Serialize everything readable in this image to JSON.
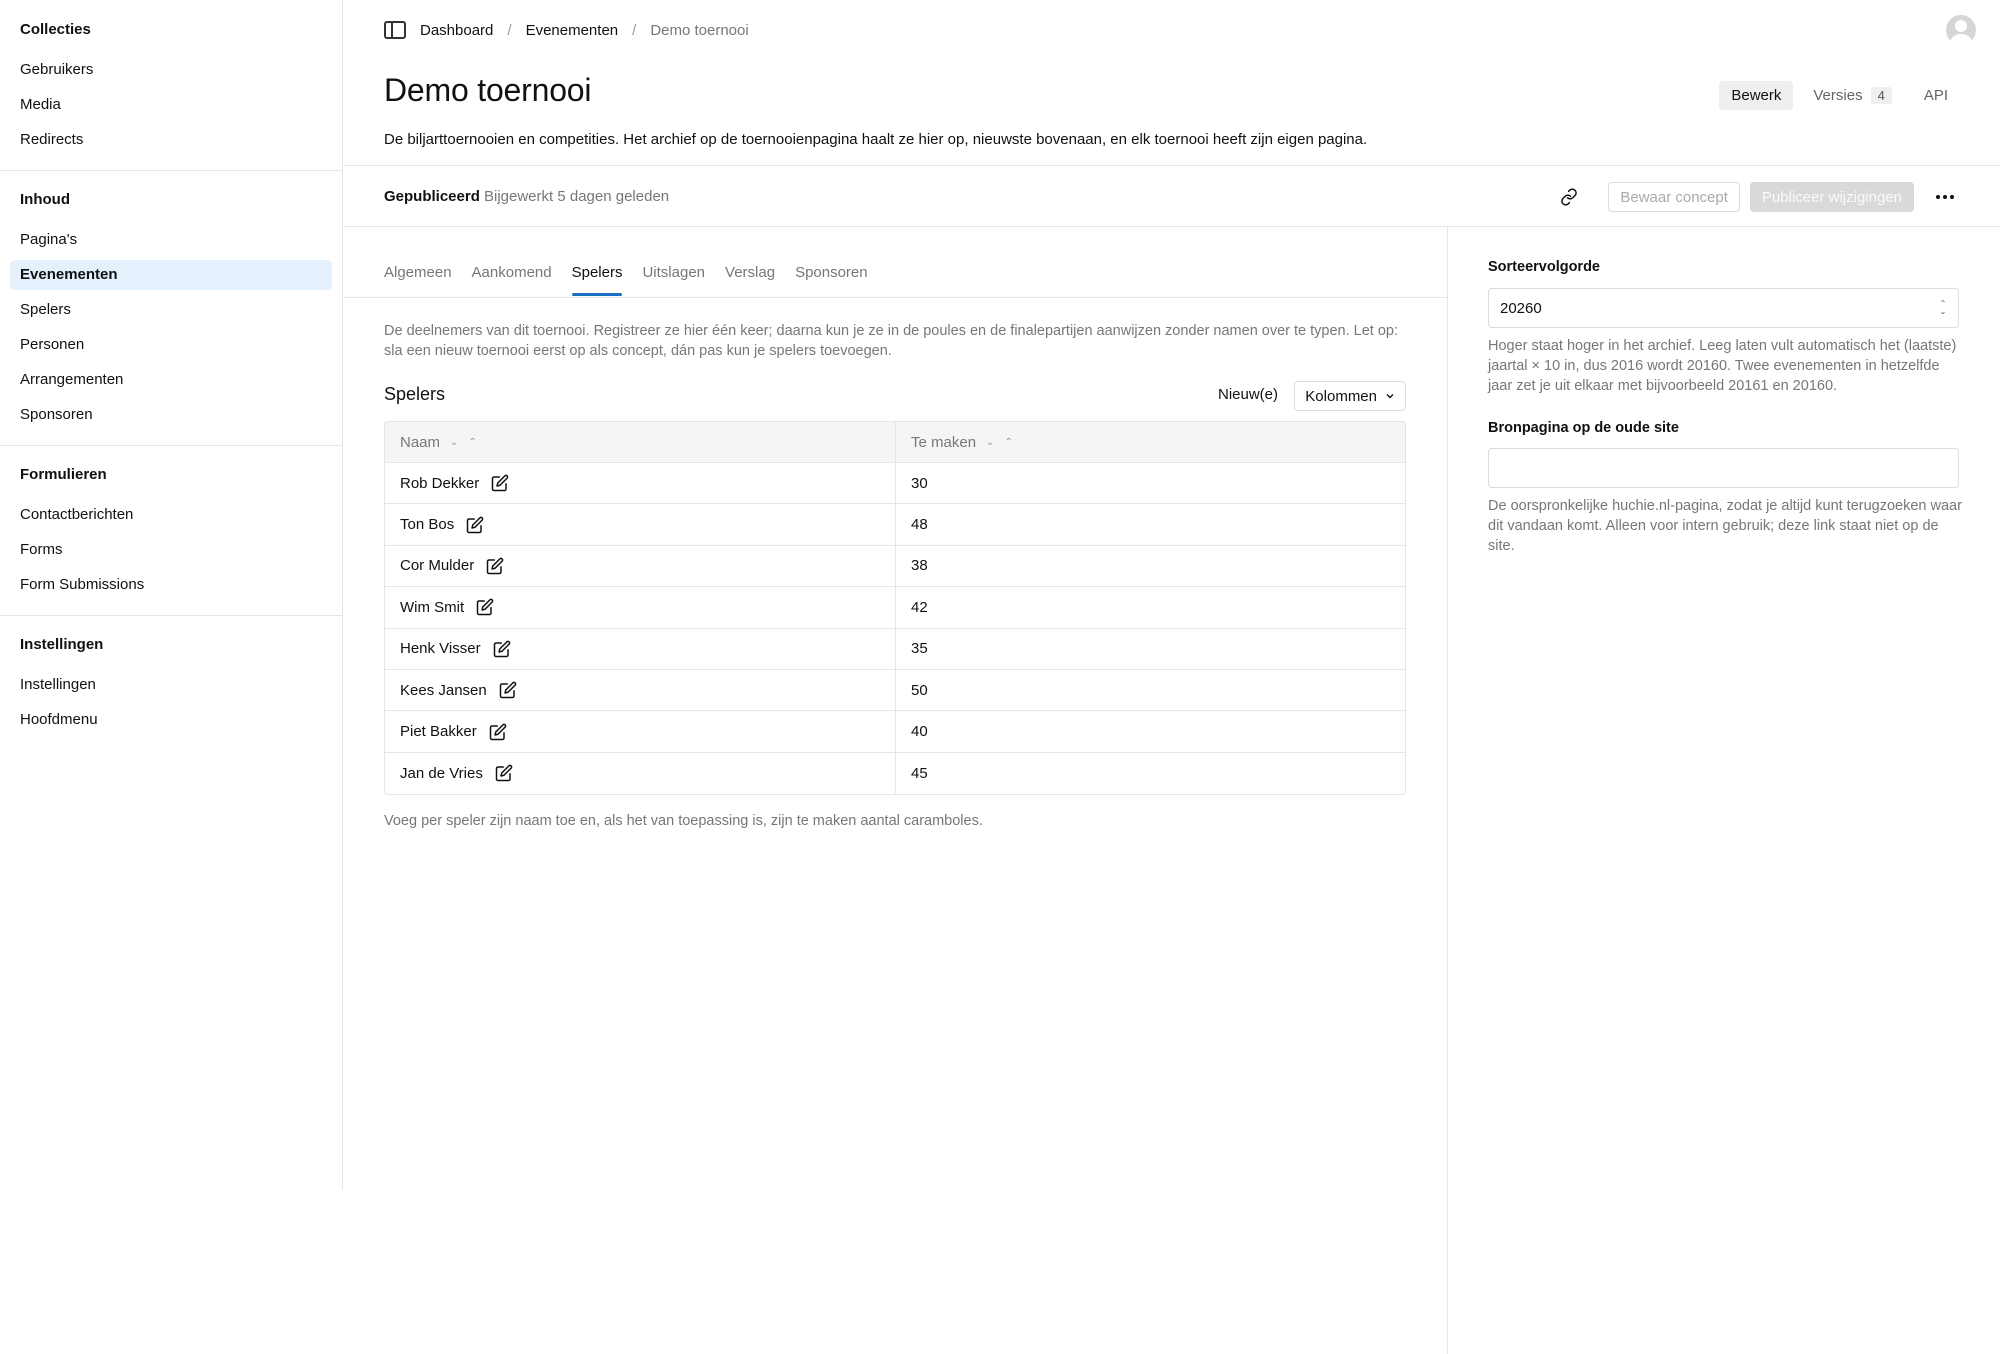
{
  "sidebar": {
    "groups": [
      {
        "title": "Collecties",
        "items": [
          "Gebruikers",
          "Media",
          "Redirects"
        ]
      },
      {
        "title": "Inhoud",
        "items": [
          "Pagina's",
          "Evenementen",
          "Spelers",
          "Personen",
          "Arrangementen",
          "Sponsoren"
        ]
      },
      {
        "title": "Formulieren",
        "items": [
          "Contactberichten",
          "Forms",
          "Form Submissions"
        ]
      },
      {
        "title": "Instellingen",
        "items": [
          "Instellingen",
          "Hoofdmenu"
        ]
      }
    ],
    "active_item": "Evenementen"
  },
  "breadcrumb": {
    "items": [
      "Dashboard",
      "Evenementen",
      "Demo toernooi"
    ]
  },
  "page": {
    "title": "Demo toernooi",
    "description": "De biljarttoernooien en competities. Het archief op de toernooienpagina haalt ze hier op, nieuwste bovenaan, en elk toernooi heeft zijn eigen pagina."
  },
  "view_tabs": {
    "edit": "Bewerk",
    "versions": "Versies",
    "versions_count": "4",
    "api": "API"
  },
  "status": {
    "label": "Gepubliceerd",
    "meta": "Bijgewerkt 5 dagen geleden",
    "save_draft": "Bewaar concept",
    "publish": "Publiceer wijzigingen"
  },
  "tabs": [
    "Algemeen",
    "Aankomend",
    "Spelers",
    "Uitslagen",
    "Verslag",
    "Sponsoren"
  ],
  "active_tab": "Spelers",
  "players_section": {
    "description": "De deelnemers van dit toernooi. Registreer ze hier één keer; daarna kun je ze in de poules en de finalepartijen aanwijzen zonder namen over te typen. Let op: sla een nieuw toernooi eerst op als concept, dán pas kun je spelers toevoegen.",
    "title": "Spelers",
    "new_label": "Nieuw(e)",
    "columns_label": "Kolommen",
    "headers": [
      "Naam",
      "Te maken"
    ],
    "rows": [
      {
        "name": "Rob Dekker",
        "target": "30"
      },
      {
        "name": "Ton Bos",
        "target": "48"
      },
      {
        "name": "Cor Mulder",
        "target": "38"
      },
      {
        "name": "Wim Smit",
        "target": "42"
      },
      {
        "name": "Henk Visser",
        "target": "35"
      },
      {
        "name": "Kees Jansen",
        "target": "50"
      },
      {
        "name": "Piet Bakker",
        "target": "40"
      },
      {
        "name": "Jan de Vries",
        "target": "45"
      }
    ],
    "help": "Voeg per speler zijn naam toe en, als het van toepassing is, zijn te maken aantal caramboles."
  },
  "right_panel": {
    "sort_label": "Sorteervolgorde",
    "sort_value": "20260",
    "sort_help": "Hoger staat hoger in het archief. Leeg laten vult automatisch het (laatste) jaartal × 10 in, dus 2016 wordt 20160. Twee evenementen in hetzelfde jaar zet je uit elkaar met bijvoorbeeld 20161 en 20160.",
    "source_label": "Bronpagina op de oude site",
    "source_value": "",
    "source_help": "De oorspronkelijke huchie.nl-pagina, zodat je altijd kunt terugzoeken waar dit vandaan komt. Alleen voor intern gebruik; deze link staat niet op de site."
  },
  "colors": {
    "accent": "#1b6fc2",
    "active_nav_bg": "#e4f1fc"
  }
}
